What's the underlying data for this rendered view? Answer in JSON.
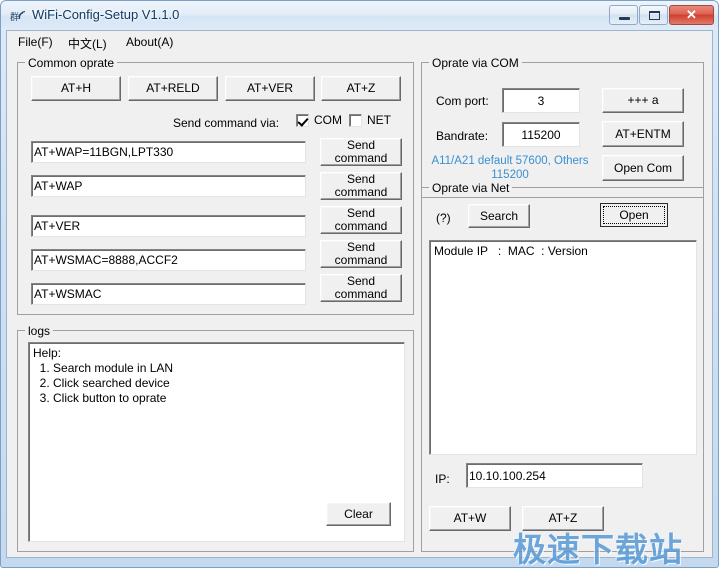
{
  "window": {
    "title": "WiFi-Config-Setup V1.1.0",
    "icon": "wifi-signal-icon",
    "minimize_label": "",
    "maximize_label": "",
    "close_label": "✕",
    "accent_blue": "#3a8fd0",
    "titlebar_text_color": "#123a66"
  },
  "menu": [
    {
      "label": "File(F)"
    },
    {
      "label": "中文(L)"
    },
    {
      "label": "About(A)"
    }
  ],
  "common_operate": {
    "caption": "Common oprate",
    "quick_buttons": [
      {
        "label": "AT+H"
      },
      {
        "label": "AT+RELD"
      },
      {
        "label": "AT+VER"
      },
      {
        "label": "AT+Z"
      }
    ],
    "send_via_label": "Send command via:",
    "checkboxes": [
      {
        "label": "COM",
        "checked": true
      },
      {
        "label": "NET",
        "checked": false
      }
    ],
    "send_button_label": "Send\ncommand",
    "commands": [
      {
        "value": "AT+WAP=11BGN,LPT330"
      },
      {
        "value": "AT+WAP"
      },
      {
        "value": "AT+VER"
      },
      {
        "value": "AT+WSMAC=8888,ACCF2"
      },
      {
        "value": "AT+WSMAC"
      }
    ]
  },
  "logs": {
    "caption": "logs",
    "lines": [
      "Help:",
      "  1. Search module in LAN",
      "  2. Click searched device",
      "  3. Click button to oprate"
    ],
    "clear_label": "Clear"
  },
  "operate_via_com": {
    "caption": "Oprate via COM",
    "com_port_label": "Com port:",
    "com_port_value": "3",
    "bandrate_label": "Bandrate:",
    "bandrate_value": "115200",
    "hint": "A11/A21 default 57600, Others\n115200",
    "buttons": [
      {
        "label": "+++ a"
      },
      {
        "label": "AT+ENTM"
      },
      {
        "label": "Open Com"
      }
    ]
  },
  "operate_via_net": {
    "caption": "Oprate via Net",
    "help_marker": "(?)",
    "search_label": "Search",
    "open_label": "Open",
    "list_header": "Module IP   :  MAC  : Version",
    "list_rows": [],
    "ip_label": "IP:",
    "ip_value": "10.10.100.254",
    "bottom_buttons": [
      {
        "label": "AT+W"
      },
      {
        "label": "AT+Z"
      }
    ]
  },
  "watermark": {
    "text": "极速下载站"
  }
}
